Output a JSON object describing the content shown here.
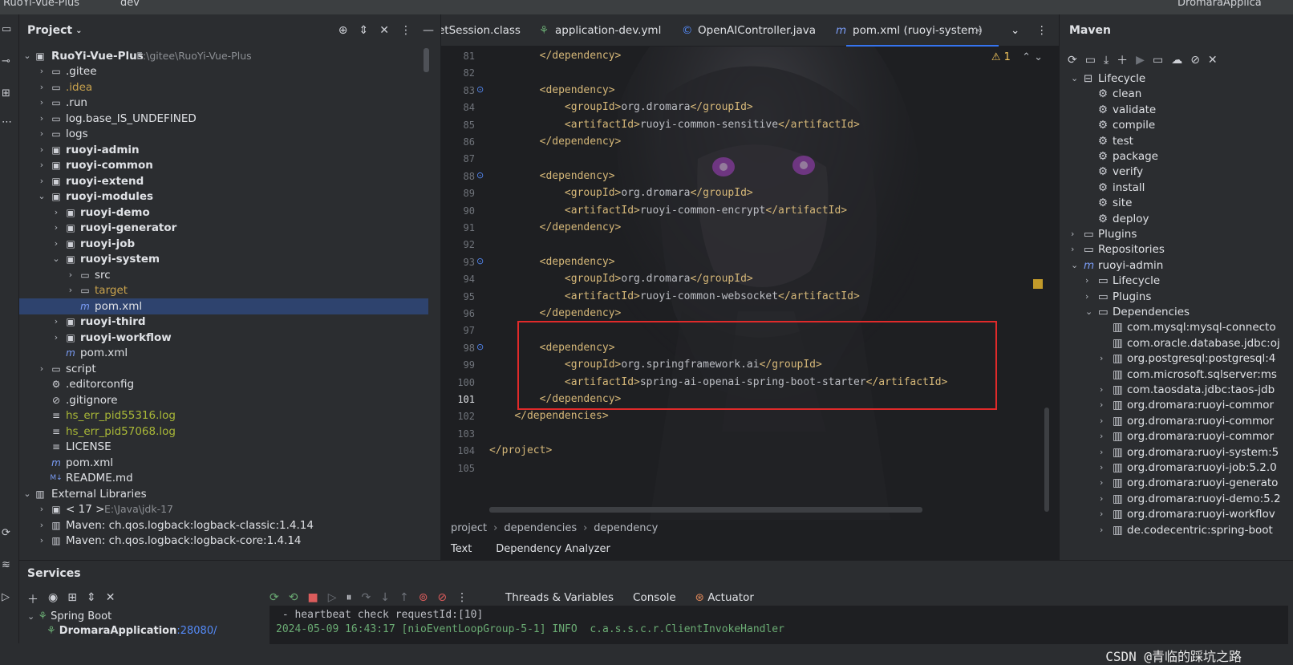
{
  "topbar": {
    "project": "RuoYi-Vue-Plus",
    "branch": "dev",
    "run_config": "DromaraApplica"
  },
  "project_panel": {
    "title": "Project",
    "root": {
      "name": "RuoYi-Vue-Plus",
      "path": "E:\\gitee\\RuoYi-Vue-Plus"
    },
    "items": [
      {
        "label": ".gitee"
      },
      {
        "label": ".idea"
      },
      {
        "label": ".run"
      },
      {
        "label": "log.base_IS_UNDEFINED"
      },
      {
        "label": "logs"
      },
      {
        "label": "ruoyi-admin"
      },
      {
        "label": "ruoyi-common"
      },
      {
        "label": "ruoyi-extend"
      },
      {
        "label": "ruoyi-modules"
      },
      {
        "label": "ruoyi-demo"
      },
      {
        "label": "ruoyi-generator"
      },
      {
        "label": "ruoyi-job"
      },
      {
        "label": "ruoyi-system"
      },
      {
        "label": "src"
      },
      {
        "label": "target"
      },
      {
        "label": "pom.xml"
      },
      {
        "label": "ruoyi-third"
      },
      {
        "label": "ruoyi-workflow"
      },
      {
        "label": "pom.xml"
      },
      {
        "label": "script"
      },
      {
        "label": ".editorconfig"
      },
      {
        "label": ".gitignore"
      },
      {
        "label": "hs_err_pid55316.log"
      },
      {
        "label": "hs_err_pid57068.log"
      },
      {
        "label": "LICENSE"
      },
      {
        "label": "pom.xml"
      },
      {
        "label": "README.md"
      },
      {
        "label": "External Libraries"
      },
      {
        "label": "< 17 >",
        "extra": "E:\\Java\\jdk-17"
      },
      {
        "label": "Maven: ch.qos.logback:logback-classic:1.4.14"
      },
      {
        "label": "Maven: ch.qos.logback:logback-core:1.4.14"
      }
    ]
  },
  "editor": {
    "tabs": [
      {
        "label": "etSession.class"
      },
      {
        "label": "application-dev.yml"
      },
      {
        "label": "OpenAIController.java"
      },
      {
        "label": "pom.xml (ruoyi-system)"
      }
    ],
    "warning_count": "1",
    "lines": [
      {
        "n": "81",
        "code": "        </dependency>"
      },
      {
        "n": "82",
        "code": ""
      },
      {
        "n": "83",
        "code": "        <dependency>"
      },
      {
        "n": "84",
        "code": "            <groupId>org.dromara</groupId>"
      },
      {
        "n": "85",
        "code": "            <artifactId>ruoyi-common-sensitive</artifactId>"
      },
      {
        "n": "86",
        "code": "        </dependency>"
      },
      {
        "n": "87",
        "code": ""
      },
      {
        "n": "88",
        "code": "        <dependency>"
      },
      {
        "n": "89",
        "code": "            <groupId>org.dromara</groupId>"
      },
      {
        "n": "90",
        "code": "            <artifactId>ruoyi-common-encrypt</artifactId>"
      },
      {
        "n": "91",
        "code": "        </dependency>"
      },
      {
        "n": "92",
        "code": ""
      },
      {
        "n": "93",
        "code": "        <dependency>"
      },
      {
        "n": "94",
        "code": "            <groupId>org.dromara</groupId>"
      },
      {
        "n": "95",
        "code": "            <artifactId>ruoyi-common-websocket</artifactId>"
      },
      {
        "n": "96",
        "code": "        </dependency>"
      },
      {
        "n": "97",
        "code": ""
      },
      {
        "n": "98",
        "code": "        <dependency>"
      },
      {
        "n": "99",
        "code": "            <groupId>org.springframework.ai</groupId>"
      },
      {
        "n": "100",
        "code": "            <artifactId>spring-ai-openai-spring-boot-starter</artifactId>"
      },
      {
        "n": "101",
        "code": "        </dependency>"
      },
      {
        "n": "102",
        "code": "    </dependencies>"
      },
      {
        "n": "103",
        "code": ""
      },
      {
        "n": "104",
        "code": "</project>"
      },
      {
        "n": "105",
        "code": ""
      }
    ],
    "breadcrumb": [
      "project",
      "dependencies",
      "dependency"
    ],
    "bottom_tabs": [
      "Text",
      "Dependency Analyzer"
    ]
  },
  "maven": {
    "title": "Maven",
    "items": [
      {
        "label": "Lifecycle"
      },
      {
        "label": "clean"
      },
      {
        "label": "validate"
      },
      {
        "label": "compile"
      },
      {
        "label": "test"
      },
      {
        "label": "package"
      },
      {
        "label": "verify"
      },
      {
        "label": "install"
      },
      {
        "label": "site"
      },
      {
        "label": "deploy"
      },
      {
        "label": "Plugins"
      },
      {
        "label": "Repositories"
      },
      {
        "label": "ruoyi-admin"
      },
      {
        "label": "Lifecycle"
      },
      {
        "label": "Plugins"
      },
      {
        "label": "Dependencies"
      },
      {
        "label": "com.mysql:mysql-connecto"
      },
      {
        "label": "com.oracle.database.jdbc:oj"
      },
      {
        "label": "org.postgresql:postgresql:4"
      },
      {
        "label": "com.microsoft.sqlserver:ms"
      },
      {
        "label": "com.taosdata.jdbc:taos-jdb"
      },
      {
        "label": "org.dromara:ruoyi-commor"
      },
      {
        "label": "org.dromara:ruoyi-commor"
      },
      {
        "label": "org.dromara:ruoyi-commor"
      },
      {
        "label": "org.dromara:ruoyi-system:5"
      },
      {
        "label": "org.dromara:ruoyi-job:5.2.0"
      },
      {
        "label": "org.dromara:ruoyi-generato"
      },
      {
        "label": "org.dromara:ruoyi-demo:5.2"
      },
      {
        "label": "org.dromara:ruoyi-workflov"
      },
      {
        "label": "de.codecentric:spring-boot"
      }
    ]
  },
  "services": {
    "title": "Services",
    "tabs": [
      "Threads & Variables",
      "Console",
      "Actuator"
    ],
    "tree": [
      {
        "label": "Spring Boot"
      },
      {
        "label": "DromaraApplication",
        "port": ":28080/"
      }
    ],
    "console_lines": [
      " - heartbeat check requestId:[10]",
      "2024-05-09 16:43:17 [nioEventLoopGroup-5-1] INFO  c.a.s.s.c.r.ClientInvokeHandler"
    ]
  },
  "watermark": "CSDN @青临的踩坑之路"
}
